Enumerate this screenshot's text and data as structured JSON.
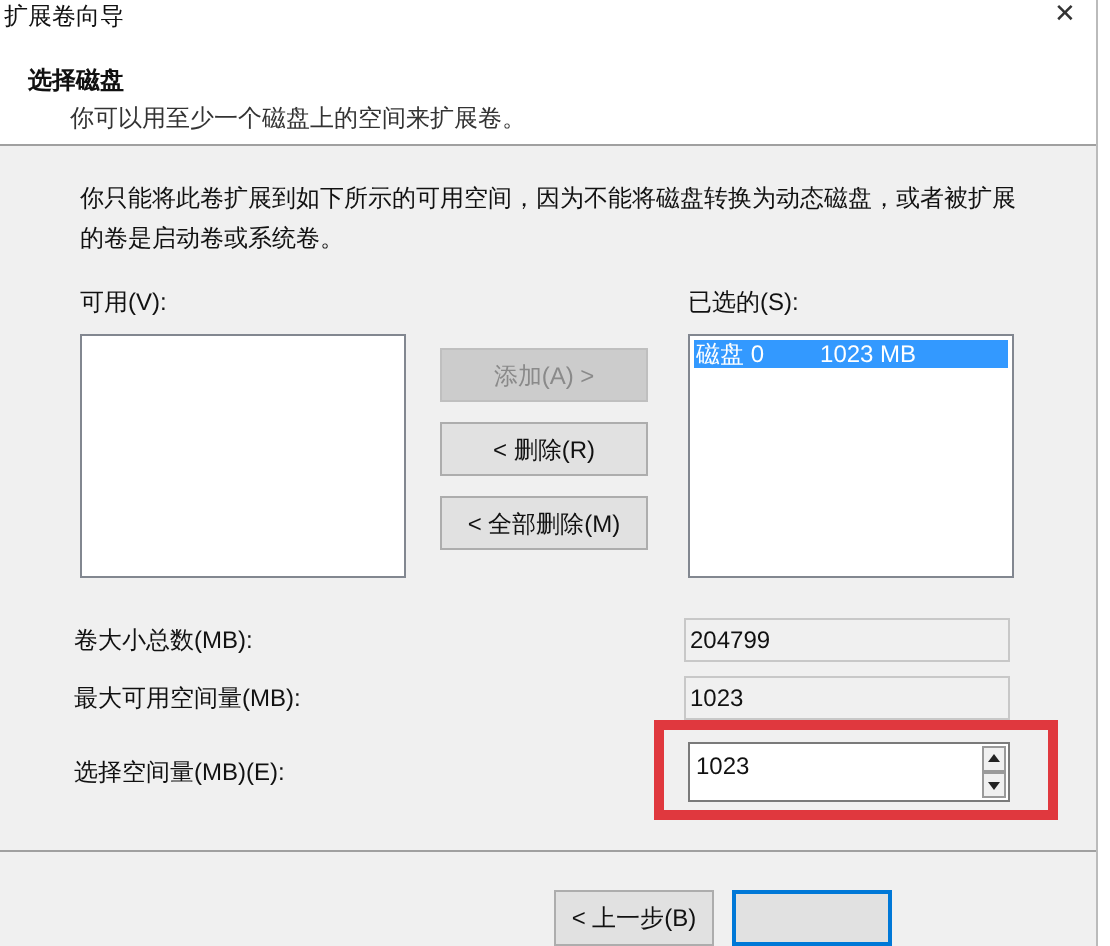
{
  "window": {
    "title": "扩展卷向导",
    "close": "✕"
  },
  "header": {
    "title": "选择磁盘",
    "subtitle": "你可以用至少一个磁盘上的空间来扩展卷。"
  },
  "notice": "你只能将此卷扩展到如下所示的可用空间，因为不能将磁盘转换为动态磁盘，或者被扩展的卷是启动卷或系统卷。",
  "available": {
    "label": "可用(V):"
  },
  "selected_list": {
    "label": "已选的(S):",
    "items": [
      {
        "disk": "磁盘 0",
        "size": "1023 MB",
        "selected": true
      }
    ]
  },
  "move_buttons": [
    {
      "label": "添加(A) >",
      "disabled": true
    },
    {
      "label": "< 删除(R)",
      "disabled": false
    },
    {
      "label": "< 全部删除(M)",
      "disabled": false
    }
  ],
  "fields": [
    {
      "label": "卷大小总数(MB):",
      "value": "204799",
      "kind": "readonly"
    },
    {
      "label": "最大可用空间量(MB):",
      "value": "1023",
      "kind": "readonly"
    },
    {
      "label": "选择空间量(MB)(E):",
      "value": "1023",
      "kind": "spin",
      "highlighted": true
    }
  ],
  "footer_buttons": [
    {
      "label": "< 上一步(B)",
      "focused": false
    },
    {
      "focused": true
    }
  ]
}
